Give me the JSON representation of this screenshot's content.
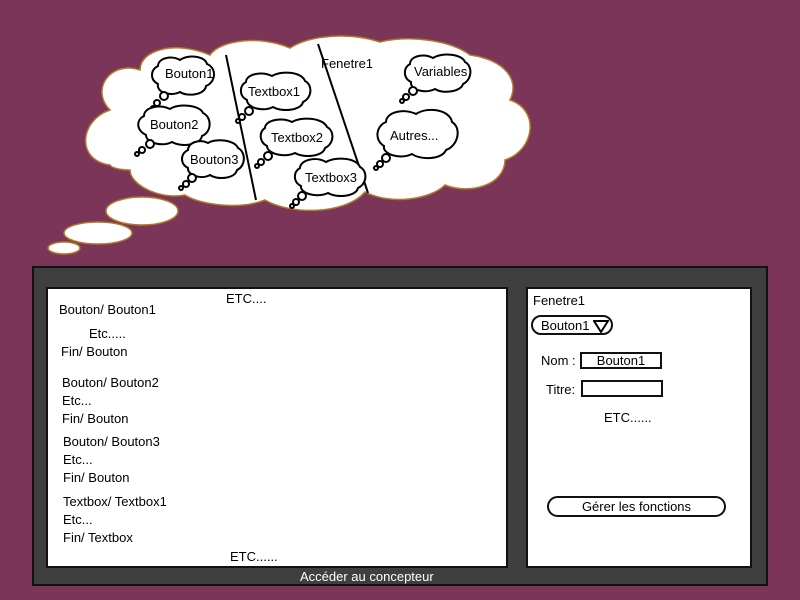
{
  "cloud": {
    "labels": {
      "bouton1": "Bouton1",
      "bouton2": "Bouton2",
      "bouton3": "Bouton3",
      "textbox1": "Textbox1",
      "textbox2": "Textbox2",
      "textbox3": "Textbox3",
      "fenetre1": "Fenetre1",
      "variables": "Variables",
      "autres": "Autres..."
    }
  },
  "code_panel": {
    "header": "ETC....",
    "lines": [
      "Bouton/ Bouton1",
      "Etc.....",
      "Fin/ Bouton",
      "Bouton/ Bouton2",
      "Etc...",
      "Fin/ Bouton",
      "Bouton/ Bouton3",
      "Etc...",
      "Fin/ Bouton",
      "Textbox/ Textbox1",
      "Etc...",
      "Fin/ Textbox"
    ],
    "footer": "ETC......"
  },
  "prop_panel": {
    "title": "Fenetre1",
    "selector_value": "Bouton1",
    "nom_label": "Nom :",
    "nom_value": "Bouton1",
    "titre_label": "Titre:",
    "titre_value": "",
    "etc": "ETC......",
    "manage_button": "Gérer les fonctions"
  },
  "footer_link": "Accéder au concepteur"
}
